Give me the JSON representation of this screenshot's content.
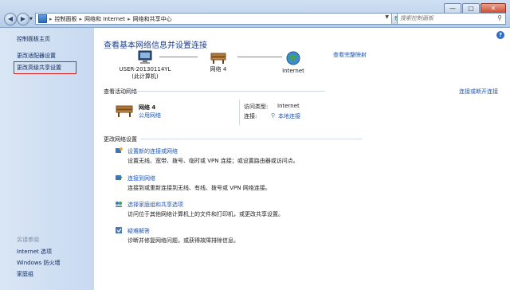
{
  "titlebar": {
    "address": {
      "crumbs": [
        "控制面板",
        "网络和 Internet",
        "网络和共享中心"
      ]
    },
    "search": {
      "placeholder": "搜索控制面板"
    },
    "buttons": {
      "minimize": "—",
      "maximize": "□",
      "close": "✕"
    }
  },
  "sidebar": {
    "links": [
      "控制面板主页",
      "更改适配器设置",
      "更改高级共享设置"
    ],
    "see_also_title": "另请参阅",
    "see_also": [
      "Internet 选项",
      "Windows 防火墙",
      "家庭组"
    ]
  },
  "main": {
    "title": "查看基本网络信息并设置连接",
    "full_map_link": "查看完整映射",
    "map": {
      "computer": {
        "name": "USER-20130114YL",
        "sub": "(此计算机)"
      },
      "network": {
        "name": "网络  4"
      },
      "internet": {
        "name": "Internet"
      }
    },
    "active_section": {
      "title": "查看活动网络",
      "connect_link": "连接或断开连接",
      "network_name": "网络  4",
      "network_type": "公用网络",
      "access_label": "访问类型:",
      "access_value": "Internet",
      "connection_label": "连接:",
      "connection_value": "本地连接"
    },
    "change_section": {
      "title": "更改网络设置",
      "tasks": [
        {
          "link": "设置新的连接或网络",
          "desc": "设置无线、宽带、拨号、临时或 VPN 连接；或设置路由器或访问点。",
          "icon": "new-connection-icon"
        },
        {
          "link": "连接到网络",
          "desc": "连接到或重新连接到无线、有线、拨号或 VPN 网络连接。",
          "icon": "connect-network-icon"
        },
        {
          "link": "选择家庭组和共享选项",
          "desc": "访问位于其他网络计算机上的文件和打印机，或更改共享设置。",
          "icon": "homegroup-icon"
        },
        {
          "link": "疑难解答",
          "desc": "诊断并修复网络问题，或获得故障排除信息。",
          "icon": "troubleshoot-icon"
        }
      ]
    }
  },
  "colors": {
    "link": "#1f56b4",
    "sidebar": "#c8daf0",
    "highlight": "#d62020"
  }
}
